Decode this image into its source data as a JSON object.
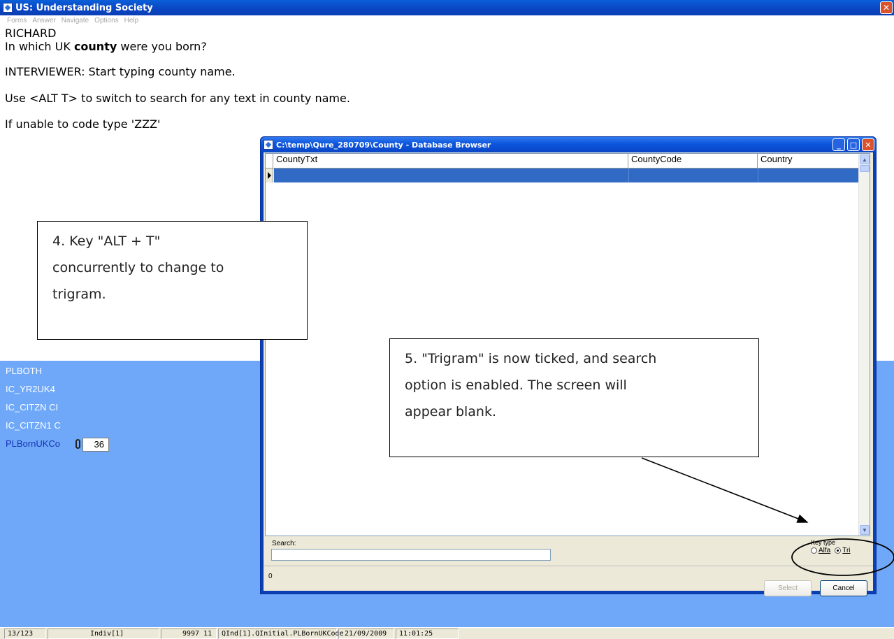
{
  "window": {
    "title": "US: Understanding Society",
    "close_glyph": "✕"
  },
  "menu": [
    "Forms",
    "Answer",
    "Navigate",
    "Options",
    "Help"
  ],
  "question": {
    "name": "RICHARD",
    "line1_pre": "In which UK ",
    "line1_bold": "county",
    "line1_post": " were you born?",
    "instruction1": "INTERVIEWER: Start typing county name.",
    "instruction2": "Use <ALT T> to switch to search for any text in county name.",
    "instruction3": "If unable to code type 'ZZZ'"
  },
  "fields": [
    {
      "label": "PLBOTH"
    },
    {
      "label": "IC_YR2UK4"
    },
    {
      "label": "IC_CITZN CI"
    },
    {
      "label": "IC_CITZN1 C"
    },
    {
      "label": "PLBornUKCo",
      "value": "36",
      "active": true
    }
  ],
  "dialog": {
    "title": "C:\\temp\\Qure_280709\\County - Database Browser",
    "columns": [
      "CountyTxt",
      "CountyCode",
      "Country"
    ],
    "search_label": "Search:",
    "search_value": "",
    "key_type_label": "Key type",
    "radio_alfa": "Alfa",
    "radio_tri": "Tri",
    "selected_key_type": "Tri",
    "count": "0",
    "select_button": "Select",
    "cancel_button": "Cancel",
    "minimize_glyph": "_",
    "maximize_glyph": "□",
    "close_glyph": "✕"
  },
  "callouts": {
    "step4": [
      "4. Key \"ALT + T\"",
      "concurrently to change to",
      "trigram."
    ],
    "step5": [
      "5. \"Trigram\" is now ticked, and search",
      "option is enabled. The screen will",
      "appear blank."
    ]
  },
  "statusbar": [
    "13/123",
    "Indiv[1]",
    "9997 11",
    "QInd[1].QInitial.PLBornUKCode",
    "21/09/2009",
    "11:01:25"
  ],
  "colors": {
    "title_blue": "#0b47c4",
    "panel_blue": "#6fa8f8",
    "selection": "#316ac5",
    "active_field": "#1533b5"
  }
}
